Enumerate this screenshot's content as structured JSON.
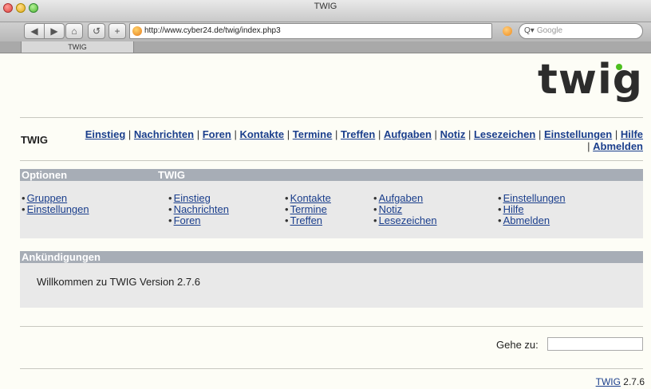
{
  "browser": {
    "window_title": "TWIG",
    "url": "http://www.cyber24.de/twig/index.php3",
    "search_placeholder": "Google",
    "tab_label": "TWIG",
    "back_glyph": "◀",
    "forward_glyph": "▶",
    "home_glyph": "⌂",
    "reload_glyph": "↺",
    "add_glyph": "+",
    "search_glyph": "Q▾"
  },
  "logo": {
    "text": "twig",
    "dot_color": "#4dbf1f"
  },
  "header": {
    "app_name": "TWIG"
  },
  "topnav": {
    "items": [
      "Einstieg",
      "Nachrichten",
      "Foren",
      "Kontakte",
      "Termine",
      "Treffen",
      "Aufgaben",
      "Notiz",
      "Lesezeichen",
      "Einstellungen",
      "Hilfe",
      "Abmelden"
    ],
    "separator": "|"
  },
  "options": {
    "heading_left": "Optionen",
    "heading_right": "TWIG",
    "bullet": "•",
    "col1": [
      "Gruppen",
      "Einstellungen"
    ],
    "col2": [
      "Einstieg",
      "Nachrichten",
      "Foren"
    ],
    "col3": [
      "Kontakte",
      "Termine",
      "Treffen"
    ],
    "col4": [
      "Aufgaben",
      "Notiz",
      "Lesezeichen"
    ],
    "col5": [
      "Einstellungen",
      "Hilfe",
      "Abmelden"
    ]
  },
  "announcements": {
    "heading": "Ankündigungen",
    "text": "Willkommen zu TWIG Version 2.7.6"
  },
  "goto": {
    "label": "Gehe zu:",
    "value": ""
  },
  "footer": {
    "link": "TWIG",
    "version": "2.7.6"
  },
  "colors": {
    "link": "#1a3e8c",
    "section_header": "#a7adb6",
    "panel": "#e9e9e9",
    "page_bg": "#fdfdf6"
  }
}
